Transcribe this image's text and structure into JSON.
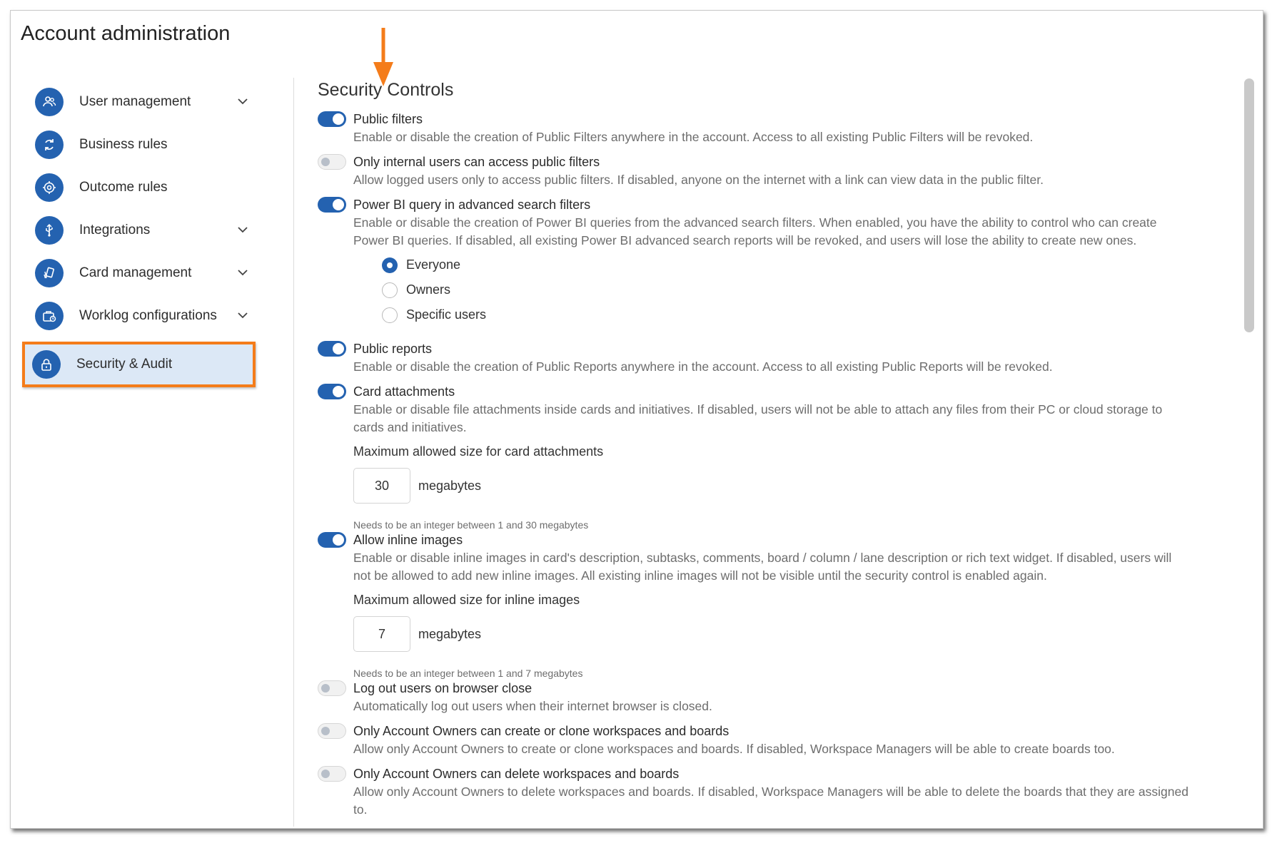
{
  "app": {
    "title": "Account administration"
  },
  "colors": {
    "accent": "#2462b0",
    "highlight": "#f47c1a",
    "active_bg": "#dce8f6"
  },
  "sidebar": {
    "items": [
      {
        "label": "User management",
        "icon": "users-icon",
        "expandable": true
      },
      {
        "label": "Business rules",
        "icon": "refresh-icon",
        "expandable": false
      },
      {
        "label": "Outcome rules",
        "icon": "target-icon",
        "expandable": false
      },
      {
        "label": "Integrations",
        "icon": "usb-icon",
        "expandable": true
      },
      {
        "label": "Card management",
        "icon": "cards-icon",
        "expandable": true
      },
      {
        "label": "Worklog configurations",
        "icon": "briefcase-clock-icon",
        "expandable": true
      },
      {
        "label": "Security & Audit",
        "icon": "lock-icon",
        "expandable": false,
        "active": true
      }
    ]
  },
  "main": {
    "section_title": "Security Controls",
    "settings": [
      {
        "title": "Public filters",
        "enabled": true,
        "description": "Enable or disable the creation of Public Filters anywhere in the account. Access to all existing Public Filters will be revoked."
      },
      {
        "title": "Only internal users can access public filters",
        "enabled": false,
        "description": "Allow logged users only to access public filters. If disabled, anyone on the internet with a link can view data in the public filter."
      },
      {
        "title": "Power BI query in advanced search filters",
        "enabled": true,
        "description_lines": [
          "Enable or disable the creation of Power BI queries from the advanced search filters. When enabled, you have the ability to control who can create",
          "Power BI queries. If disabled, all existing Power BI advanced search reports will be revoked, and users will lose the ability to create new ones."
        ],
        "radio_options": [
          {
            "label": "Everyone",
            "checked": true
          },
          {
            "label": "Owners",
            "checked": false
          },
          {
            "label": "Specific users",
            "checked": false
          }
        ]
      },
      {
        "title": "Public reports",
        "enabled": true,
        "description": "Enable or disable the creation of Public Reports anywhere in the account. Access to all existing Public Reports will be revoked."
      },
      {
        "title": "Card attachments",
        "enabled": true,
        "description_lines": [
          "Enable or disable file attachments inside cards and initiatives. If disabled, users will not be able to attach any files from their PC or cloud storage to",
          "cards and initiatives."
        ],
        "field_label": "Maximum allowed size for card attachments",
        "value": "30",
        "unit": "megabytes",
        "hint": "Needs to be an integer between 1 and 30 megabytes"
      },
      {
        "title": "Allow inline images",
        "enabled": true,
        "description_lines": [
          "Enable or disable inline images in card's description, subtasks, comments, board / column / lane description or rich text widget. If disabled, users will",
          "not be allowed to add new inline images. All existing inline images will not be visible until the security control is enabled again."
        ],
        "field_label": "Maximum allowed size for inline images",
        "value": "7",
        "unit": "megabytes",
        "hint": "Needs to be an integer between 1 and 7 megabytes"
      },
      {
        "title": "Log out users on browser close",
        "enabled": false,
        "description": "Automatically log out users when their internet browser is closed."
      },
      {
        "title": "Only Account Owners can create or clone workspaces and boards",
        "enabled": false,
        "description": "Allow only Account Owners to create or clone workspaces and boards. If disabled, Workspace Managers will be able to create boards too."
      },
      {
        "title": "Only Account Owners can delete workspaces and boards",
        "enabled": false,
        "description_lines": [
          "Allow only Account Owners to delete workspaces and boards. If disabled, Workspace Managers will be able to delete the boards that they are assigned",
          "to."
        ]
      }
    ]
  }
}
